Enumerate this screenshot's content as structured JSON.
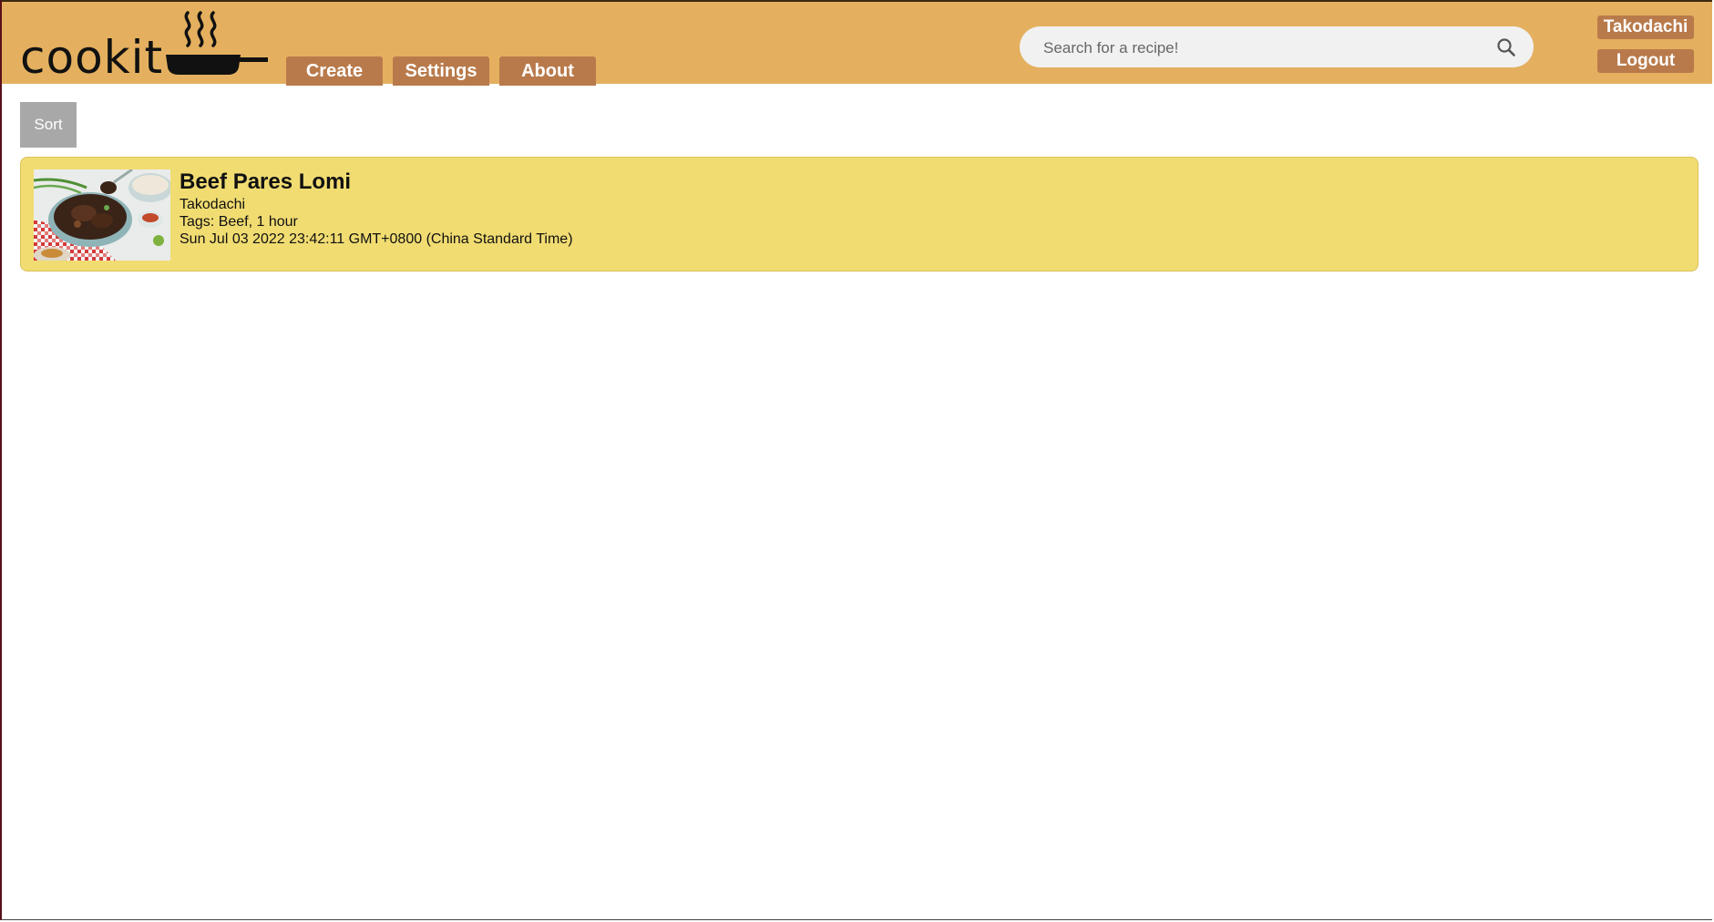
{
  "header": {
    "logo_text": "cookit",
    "nav": [
      {
        "label": "Create"
      },
      {
        "label": "Settings"
      },
      {
        "label": "About"
      }
    ],
    "search": {
      "placeholder": "Search for a recipe!"
    },
    "user": {
      "username": "Takodachi",
      "logout_label": "Logout"
    }
  },
  "toolbar": {
    "sort_label": "Sort"
  },
  "recipes": [
    {
      "title": "Beef Pares Lomi",
      "author": "Takodachi",
      "tags": "Tags: Beef, 1 hour",
      "date": "Sun Jul 03 2022 23:42:11 GMT+0800 (China Standard Time)"
    }
  ],
  "colors": {
    "header_bg": "#e4b05f",
    "nav_button_bg": "#b97a4b",
    "card_bg": "#f1dc72",
    "sort_bg": "#a8a8a8"
  }
}
